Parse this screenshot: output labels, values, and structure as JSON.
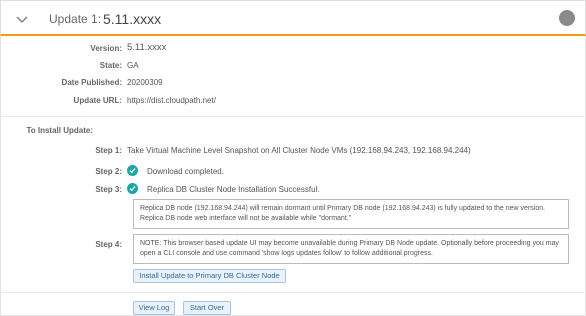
{
  "header": {
    "title": "Update 1:",
    "version": "5.11.xxxx"
  },
  "details": {
    "version_label": "Version:",
    "version_value": "5.11.xxxx",
    "state_label": "State:",
    "state_value": "GA",
    "date_label": "Date Published:",
    "date_value": "20200309",
    "url_label": "Update URL:",
    "url_value": "https://dist.cloudpath.net/"
  },
  "install": {
    "heading": "To Install Update:",
    "step1_label": "Step 1:",
    "step1_text": "Take Virtual Machine Level Snapshot on All Cluster Node VMs (192.168.94.243, 192.168.94.244)",
    "step2_label": "Step 2:",
    "step2_text": "Download completed.",
    "step3_label": "Step 3:",
    "step3_text": "Replica DB Cluster Node Installation Successful.",
    "step3_note": "Replica DB node (192.168.94.244) will remain dormant until Primary DB node (192.168.94.243) is fully updated to the new version. Replica DB node web interface will not be available while \"dormant.\"",
    "step4_label": "Step 4:",
    "step4_note": "NOTE: This browser based update UI may become unavailable during Primary DB Node update. Optionally before proceeding you may open a CLI console and use command 'show logs updates follow' to follow additional progress.",
    "install_button": "Install Update to Primary DB Cluster Node"
  },
  "footer": {
    "view_log": "View Log",
    "start_over": "Start Over"
  },
  "colors": {
    "accent": "#f39c12",
    "success": "#1fa5a5",
    "button_text": "#2f6da8"
  }
}
